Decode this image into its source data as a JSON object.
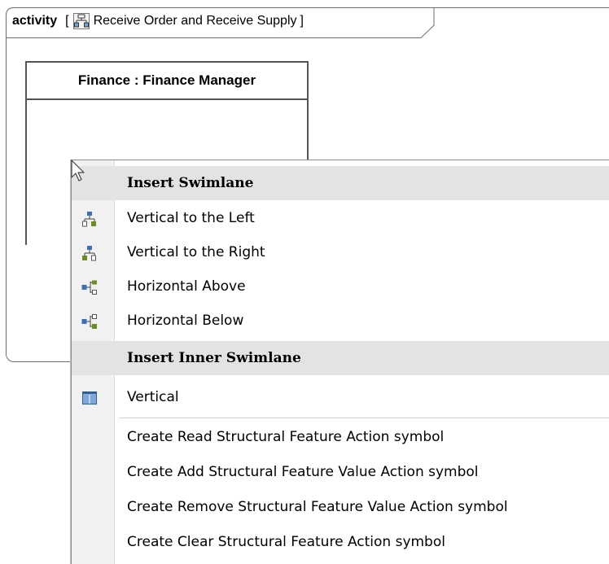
{
  "diagram": {
    "kind": "activity",
    "open_bracket": "[",
    "name": "Receive Order and Receive Supply",
    "close_bracket": "]"
  },
  "swimlane": {
    "title": "Finance : Finance Manager"
  },
  "context_menu": {
    "sections": [
      {
        "header": "Insert Swimlane",
        "items": [
          {
            "label": "Vertical to the Left",
            "icon": "vertical-left-swimlane-icon"
          },
          {
            "label": "Vertical to the Right",
            "icon": "vertical-right-swimlane-icon"
          },
          {
            "label": "Horizontal Above",
            "icon": "horizontal-above-swimlane-icon"
          },
          {
            "label": "Horizontal Below",
            "icon": "horizontal-below-swimlane-icon"
          }
        ]
      },
      {
        "header": "Insert Inner Swimlane",
        "items": [
          {
            "label": "Vertical",
            "icon": "vertical-inner-swimlane-icon"
          }
        ]
      }
    ],
    "commands": [
      "Create Read Structural Feature Action symbol",
      "Create Add Structural Feature Value Action symbol",
      "Create Remove Structural Feature Value Action symbol",
      "Create Clear Structural Feature Action symbol"
    ]
  }
}
